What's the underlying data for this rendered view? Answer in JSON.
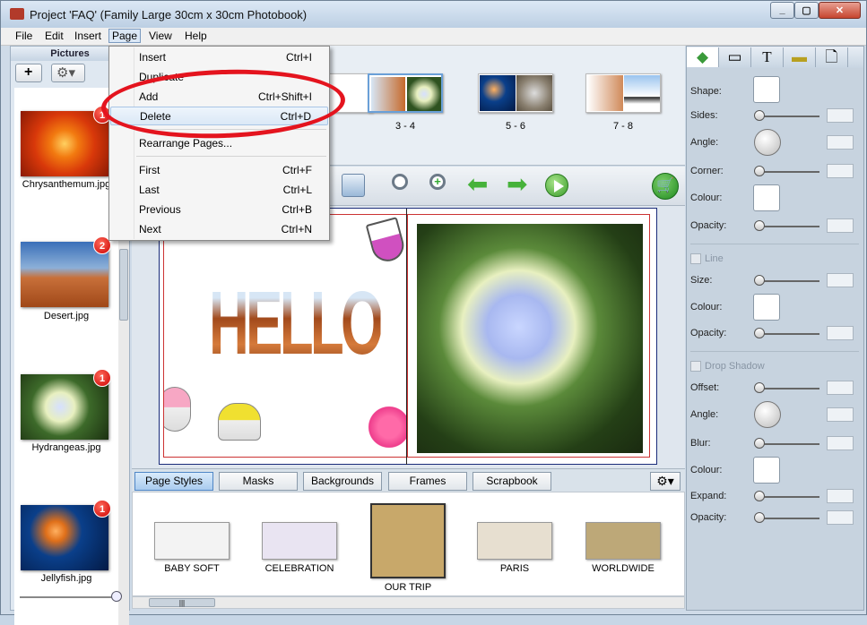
{
  "window": {
    "title": "Project 'FAQ' (Family Large 30cm x 30cm Photobook)"
  },
  "menubar": {
    "items": [
      "File",
      "Edit",
      "Insert",
      "Page",
      "View",
      "Help"
    ]
  },
  "page_menu": {
    "items": [
      {
        "label": "Insert",
        "shortcut": "Ctrl+I"
      },
      {
        "label": "Duplicate",
        "shortcut": ""
      },
      {
        "label": "Add",
        "shortcut": "Ctrl+Shift+I"
      },
      {
        "label": "Delete",
        "shortcut": "Ctrl+D"
      },
      {
        "label": "Rearrange Pages...",
        "shortcut": ""
      },
      {
        "label": "First",
        "shortcut": "Ctrl+F"
      },
      {
        "label": "Last",
        "shortcut": "Ctrl+L"
      },
      {
        "label": "Previous",
        "shortcut": "Ctrl+B"
      },
      {
        "label": "Next",
        "shortcut": "Ctrl+N"
      }
    ]
  },
  "pictures": {
    "header": "Pictures",
    "items": [
      {
        "name": "Chrysanthemum.jpg",
        "badge": "1"
      },
      {
        "name": "Desert.jpg",
        "badge": "2"
      },
      {
        "name": "Hydrangeas.jpg",
        "badge": "1"
      },
      {
        "name": "Jellyfish.jpg",
        "badge": "1"
      }
    ]
  },
  "page_strip": {
    "spreads": [
      "3 - 4",
      "5 - 6",
      "7 - 8"
    ]
  },
  "canvas": {
    "hello_text": "HELLO"
  },
  "style_tabs": [
    "Page Styles",
    "Masks",
    "Backgrounds",
    "Frames",
    "Scrapbook"
  ],
  "styles": [
    "BABY SOFT",
    "CELEBRATION",
    "OUR TRIP",
    "PARIS",
    "WORLDWIDE"
  ],
  "props": {
    "shape": "Shape:",
    "sides": "Sides:",
    "angle": "Angle:",
    "corner": "Corner:",
    "colour": "Colour:",
    "opacity": "Opacity:",
    "line": "Line",
    "size": "Size:",
    "line_colour": "Colour:",
    "line_opacity": "Opacity:",
    "drop_shadow": "Drop Shadow",
    "offset": "Offset:",
    "ds_angle": "Angle:",
    "blur": "Blur:",
    "ds_colour": "Colour:",
    "expand": "Expand:",
    "ds_opacity": "Opacity:"
  },
  "colors": {
    "highlight_ellipse": "#e4141e",
    "accent": "#4f86c6",
    "badge": "#cc0000"
  },
  "icons": [
    "app-icon",
    "add-icon",
    "gear-icon",
    "zoom-out-icon",
    "zoom-in-icon",
    "arrow-left-icon",
    "arrow-right-icon",
    "play-icon",
    "cart-icon",
    "shape-tab-icon",
    "frame-tab-icon",
    "text-tab-icon",
    "ruler-tab-icon",
    "page-tab-icon"
  ]
}
